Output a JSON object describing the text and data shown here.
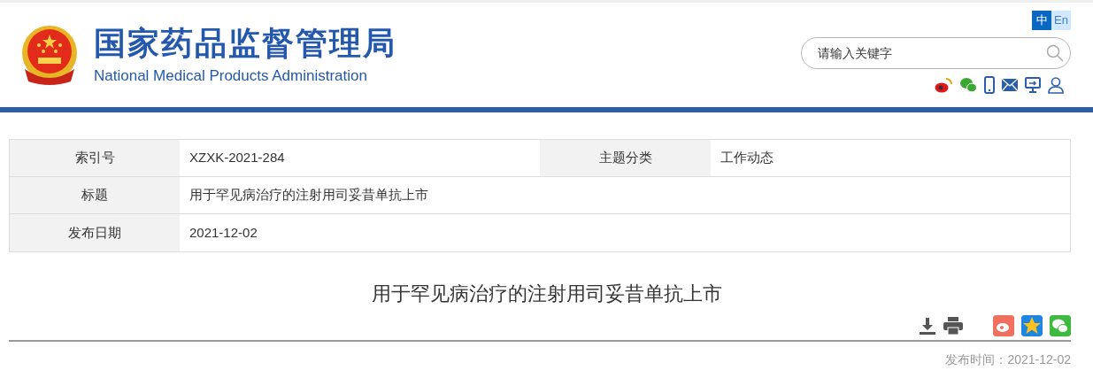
{
  "header": {
    "title": "国家药品监督管理局",
    "subtitle": "National Medical Products Administration"
  },
  "languages": [
    {
      "label": "中",
      "selected": true
    },
    {
      "label": "En",
      "selected": false
    }
  ],
  "search": {
    "placeholder": "请输入关键字"
  },
  "meta": [
    {
      "cells": [
        {
          "label": "索引号",
          "value": "XZXK-2021-284"
        },
        {
          "label": "主题分类",
          "value": "工作动态"
        }
      ]
    },
    {
      "cells": [
        {
          "label": "标题",
          "value": "用于罕见病治疗的注射用司妥昔单抗上市"
        }
      ]
    },
    {
      "cells": [
        {
          "label": "发布日期",
          "value": "2021-12-02"
        }
      ]
    }
  ],
  "article": {
    "title": "用于罕见病治疗的注射用司妥昔单抗上市",
    "publish_time": "发布时间：2021-12-02"
  }
}
